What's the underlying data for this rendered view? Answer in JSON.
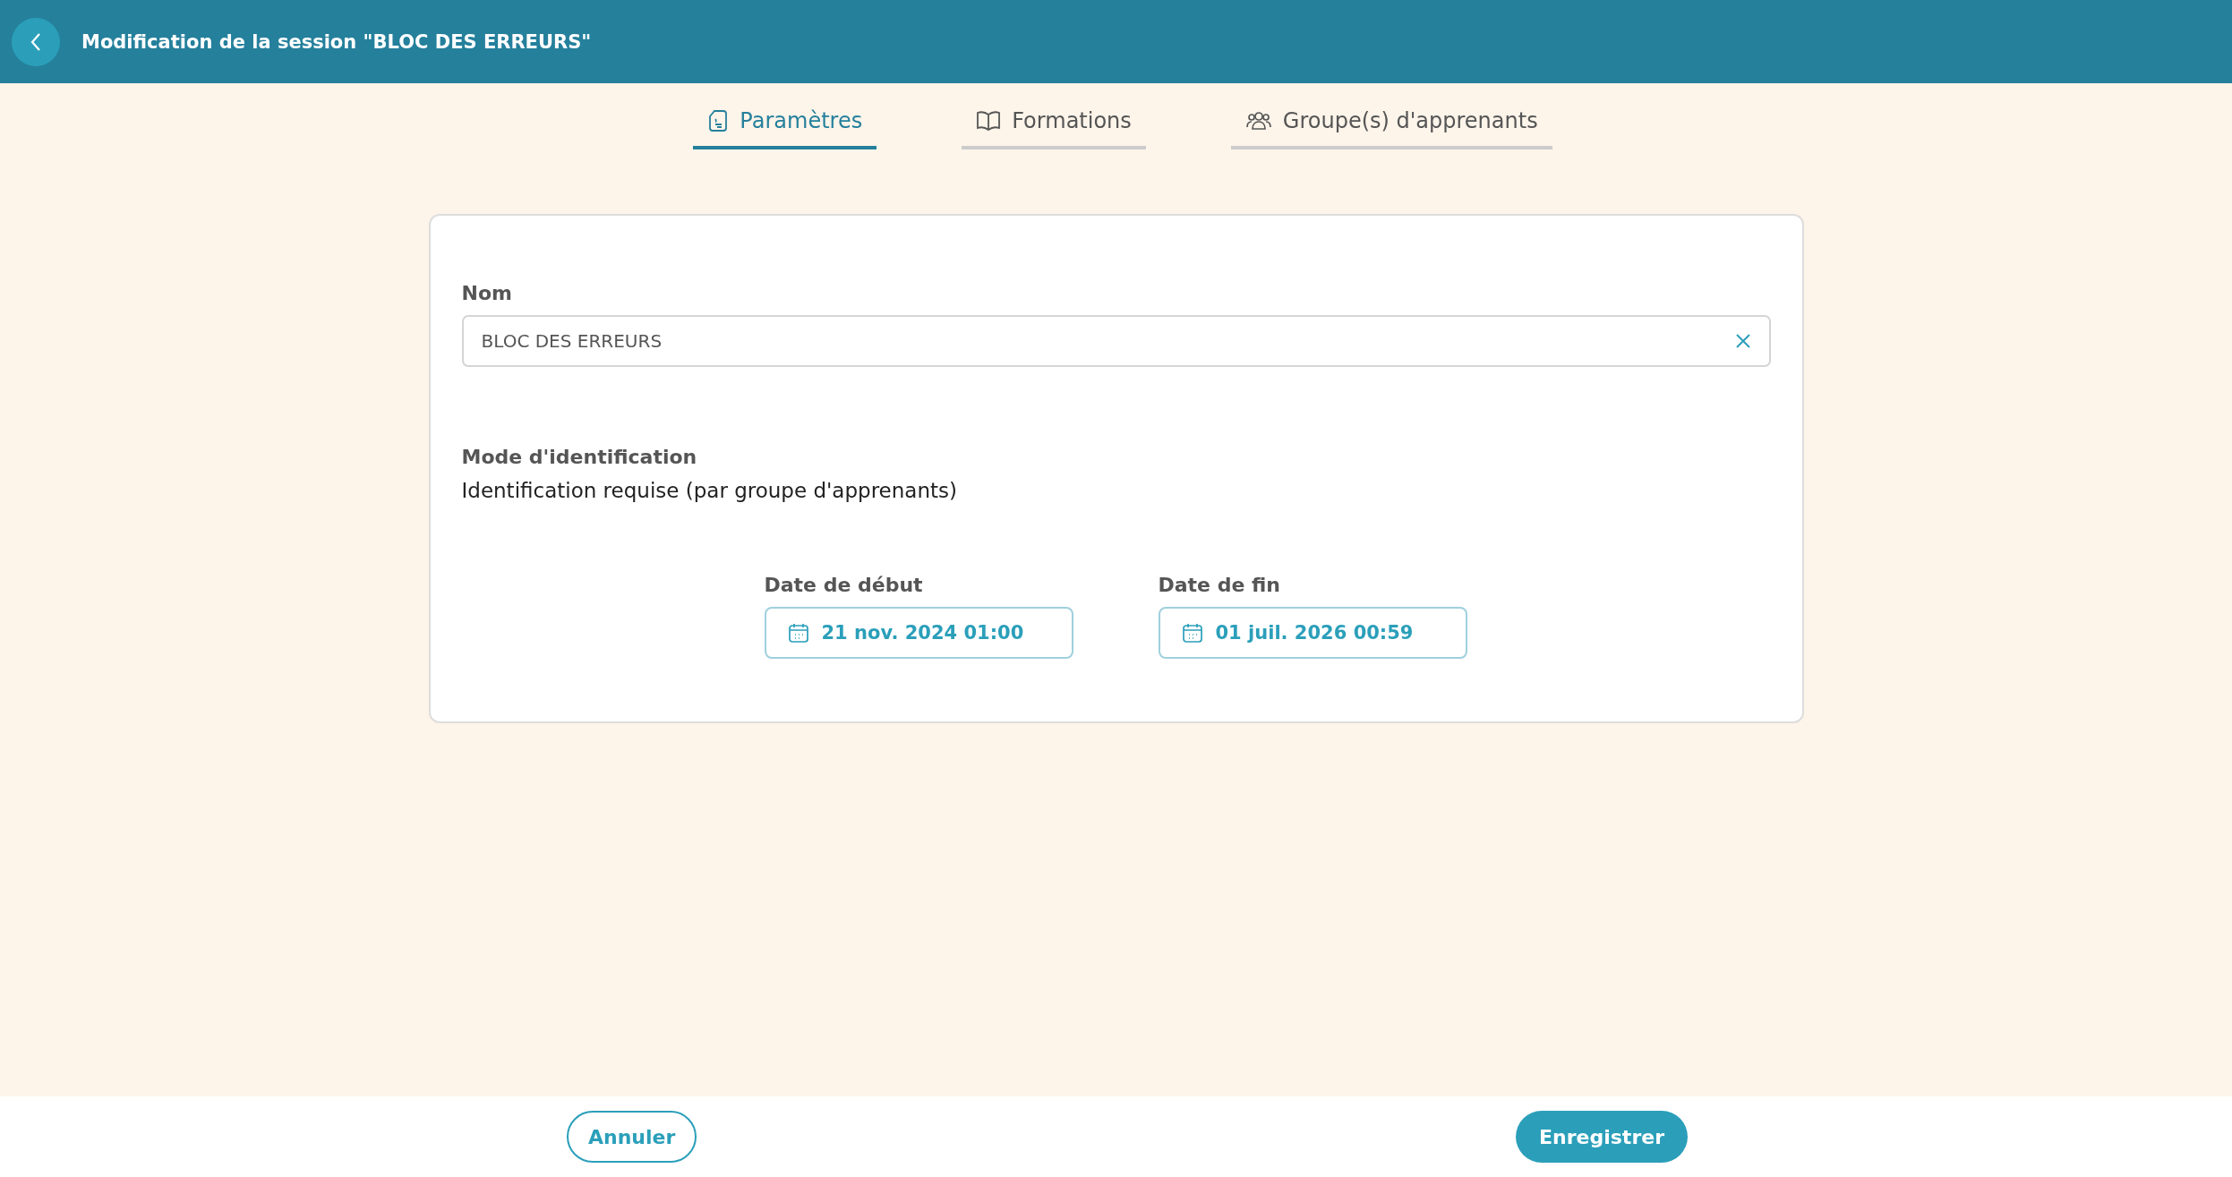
{
  "header": {
    "title": "Modification de la session \"BLOC DES ERREURS\""
  },
  "tabs": [
    {
      "label": "Paramètres",
      "selected": true
    },
    {
      "label": "Formations",
      "selected": false
    },
    {
      "label": "Groupe(s) d'apprenants",
      "selected": false
    }
  ],
  "form": {
    "name_label": "Nom",
    "name_value": "BLOC DES ERREURS",
    "mode_label": "Mode d'identification",
    "mode_value": "Identification requise (par groupe d'apprenants)",
    "dates": [
      {
        "label": "Date de début",
        "value": "21 nov. 2024 01:00"
      },
      {
        "label": "Date de fin",
        "value": "01 juil. 2026 00:59"
      }
    ]
  },
  "footer": {
    "cancel": "Annuler",
    "save": "Enregistrer"
  }
}
